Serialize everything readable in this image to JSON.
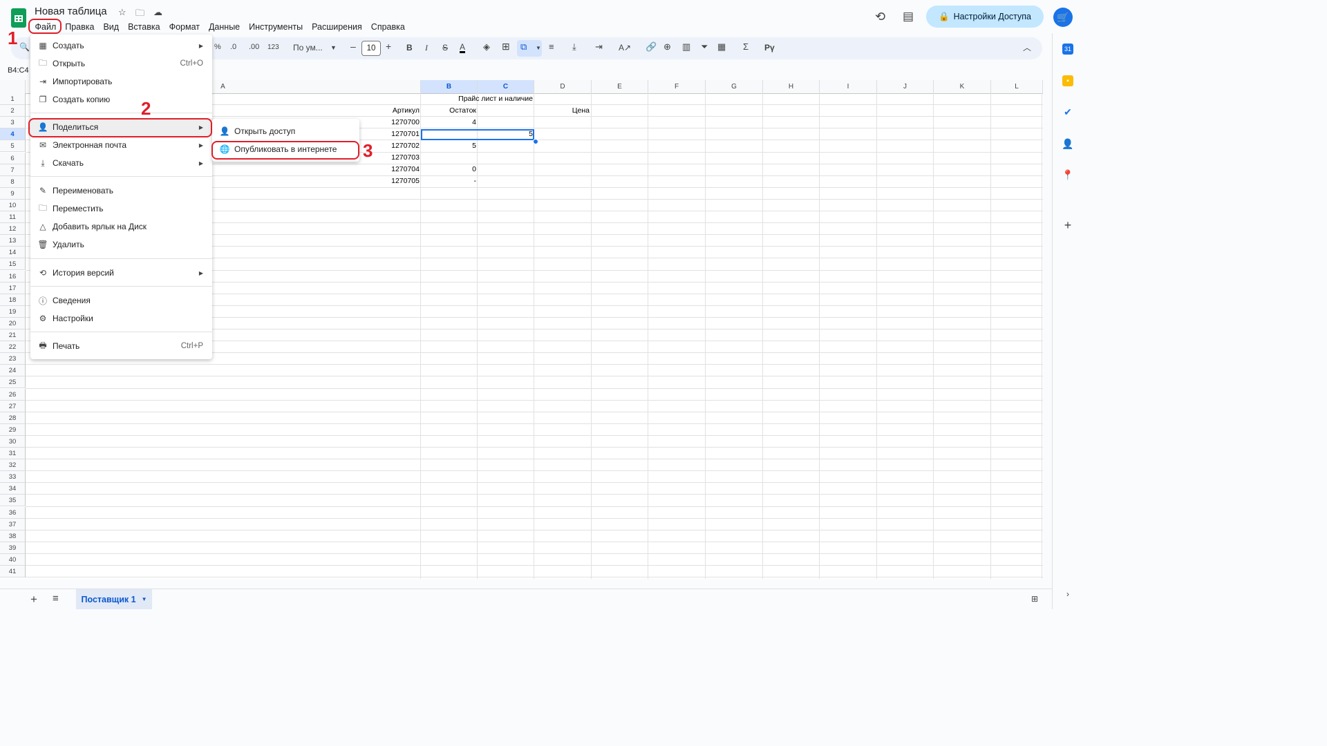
{
  "app": {
    "doc_title": "Новая таблица",
    "share_button_label": "Настройки Доступа",
    "avatar_glyph": "🛒"
  },
  "menubar": [
    "Файл",
    "Правка",
    "Вид",
    "Вставка",
    "Формат",
    "Данные",
    "Инструменты",
    "Расширения",
    "Справка"
  ],
  "toolbar": {
    "percent": "%",
    "dec_less": ".0",
    "dec_more": ".00",
    "format_123": "123",
    "font_name": "По ум...",
    "font_size": "10",
    "bold": "B",
    "italic": "I",
    "strike": "S",
    "text_color": "A",
    "sum": "Σ",
    "input_tools": "Рү"
  },
  "namebox": "B4:C4",
  "columns": [
    "A",
    "B",
    "C",
    "D",
    "E",
    "F",
    "G",
    "H",
    "I",
    "J",
    "K",
    "L"
  ],
  "rows": [
    "1",
    "2",
    "3",
    "4",
    "5",
    "6",
    "7",
    "8",
    "9",
    "10",
    "11",
    "12",
    "13",
    "14",
    "15",
    "16",
    "17",
    "18",
    "19",
    "20",
    "21",
    "22",
    "23",
    "24",
    "25",
    "26",
    "27",
    "28",
    "29",
    "30",
    "31",
    "32",
    "33",
    "34",
    "35",
    "36",
    "37",
    "38",
    "39",
    "40",
    "41"
  ],
  "cells": {
    "title": "Прайс лист и наличие",
    "hdr_article": "Артикул",
    "hdr_stock": "Остаток",
    "hdr_price": "Цена",
    "articles": [
      "1270700",
      "1270701",
      "1270702",
      "1270703",
      "1270704",
      "1270705"
    ],
    "stock": [
      "4",
      "",
      "5",
      "",
      "0",
      "-"
    ],
    "c4": "5"
  },
  "file_menu": {
    "create": "Создать",
    "open": "Открыть",
    "open_shortcut": "Ctrl+O",
    "import": "Импортировать",
    "copy": "Создать копию",
    "share": "Поделиться",
    "email": "Электронная почта",
    "download": "Скачать",
    "rename": "Переименовать",
    "move": "Переместить",
    "shortcut": "Добавить ярлык на Диск",
    "delete": "Удалить",
    "history": "История версий",
    "details": "Сведения",
    "settings": "Настройки",
    "print": "Печать",
    "print_shortcut": "Ctrl+P"
  },
  "share_submenu": {
    "open_access": "Открыть доступ",
    "publish": "Опубликовать в интернете"
  },
  "sheet_tab": "Поставщик 1",
  "annotations": {
    "n1": "1",
    "n2": "2",
    "n3": "3"
  },
  "colors": {
    "accent": "#1a73e8",
    "annotation": "#e01e28",
    "sheets_green": "#0f9d58"
  }
}
